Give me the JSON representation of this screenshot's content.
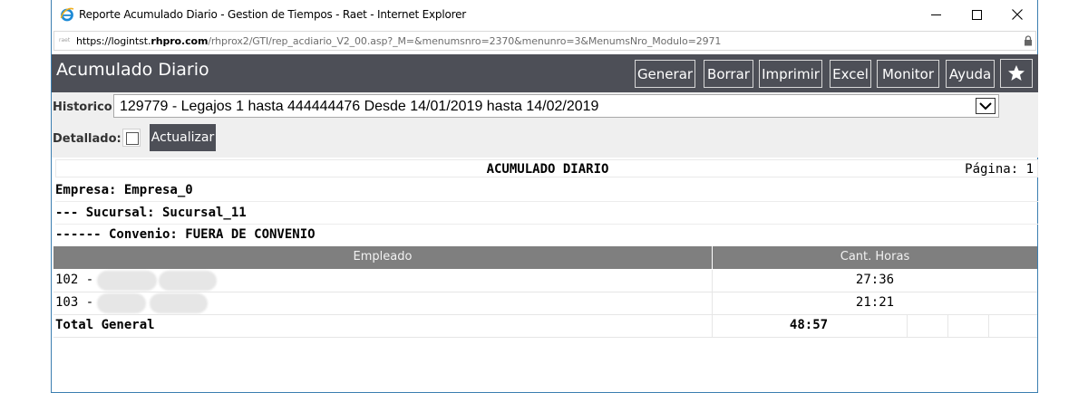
{
  "window": {
    "title": "Reporte Acumulado Diario - Gestion de Tiempos - Raet - Internet Explorer",
    "address_prefix": "https://logintst.",
    "address_domain": "rhpro.com",
    "address_path": "/rhprox2/GTI/rep_acdiario_V2_00.asp?_M=&menumsnro=2370&menunro=3&MenumsNro_Modulo=2971",
    "favicon_text": "raet"
  },
  "header": {
    "title": "Acumulado Diario",
    "buttons": [
      "Generar",
      "Borrar",
      "Imprimir",
      "Excel",
      "Monitor",
      "Ayuda"
    ]
  },
  "filters": {
    "historico_label": "Historico:",
    "historico_value": "129779 - Legajos 1 hasta 444444476 Desde 14/01/2019 hasta 14/02/2019",
    "detallado_label": "Detallado:",
    "detallado_checked": false,
    "update_label": "Actualizar"
  },
  "report": {
    "title": "ACUMULADO DIARIO",
    "page": "Página: 1",
    "empresa": "Empresa: Empresa_0",
    "sucursal": "--- Sucursal: Sucursal_11",
    "convenio": "------ Convenio: FUERA DE CONVENIO",
    "columns": [
      "Empleado",
      "Cant. Horas"
    ],
    "rows": [
      {
        "employee": "102 -",
        "hours": "27:36"
      },
      {
        "employee": "103 -",
        "hours": "21:21"
      }
    ],
    "total_label": "Total General",
    "total_hours": "48:57"
  },
  "colors": {
    "header_bg": "#4d4f57",
    "filter_bg": "#efefef",
    "table_header_bg": "#7f7f7f",
    "window_border": "#3c7fb1"
  }
}
